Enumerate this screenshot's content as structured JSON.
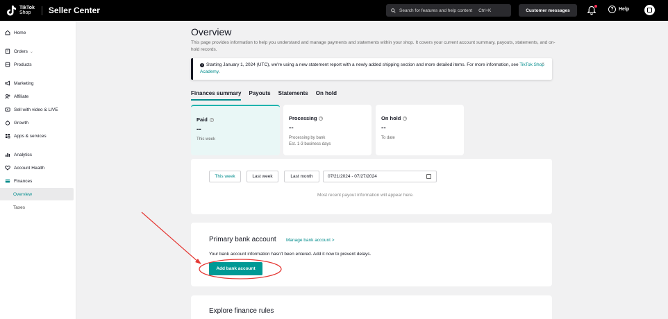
{
  "topbar": {
    "logo_text_line1": "TikTok",
    "logo_text_line2": "Shop",
    "app_name": "Seller Center",
    "search_placeholder": "Search for features and help content",
    "search_shortcut": "Ctrl+K",
    "customer_messages": "Customer messages",
    "help": "Help",
    "help_glyph": "?"
  },
  "sidebar": {
    "items": [
      {
        "label": "Home",
        "icon": "home-icon"
      },
      {
        "label": "Orders",
        "icon": "orders-icon",
        "chevron": "⌄"
      },
      {
        "label": "Products",
        "icon": "products-icon"
      },
      {
        "label": "Marketing",
        "icon": "marketing-icon"
      },
      {
        "label": "Affiliate",
        "icon": "affiliate-icon"
      },
      {
        "label": "Sell with video & LIVE",
        "icon": "video-icon"
      },
      {
        "label": "Growth",
        "icon": "growth-icon"
      },
      {
        "label": "Apps & services",
        "icon": "apps-icon"
      },
      {
        "label": "Analytics",
        "icon": "analytics-icon"
      },
      {
        "label": "Account Health",
        "icon": "account-health-icon"
      },
      {
        "label": "Finances",
        "icon": "finances-icon"
      }
    ],
    "subitems": [
      {
        "label": "Overview",
        "active": true
      },
      {
        "label": "Taxes"
      }
    ]
  },
  "page": {
    "title": "Overview",
    "description": "This page provides information to help you understand and manage payments and statements within your shop. It covers your current account summary, payouts, statements, and on-hold records."
  },
  "notice": {
    "text": "Starting January 1, 2024 (UTC), we're using a new statement report with a newly added shipping section and more detailed items. For more information, see ",
    "link": "TikTok Shop Academy",
    "period": ".",
    "info_glyph": "i",
    "close_glyph": "×"
  },
  "tabs": [
    "Finances summary",
    "Payouts",
    "Statements",
    "On hold"
  ],
  "cards": [
    {
      "title": "Paid",
      "value": "--",
      "sub1": "This week",
      "sub2": ""
    },
    {
      "title": "Processing",
      "value": "--",
      "sub1": "Processing by bank",
      "sub2": "Est. 1-3 business days"
    },
    {
      "title": "On hold",
      "value": "--",
      "sub1": "To date",
      "sub2": ""
    }
  ],
  "card_help_glyph": "?",
  "payouts": {
    "buttons": [
      "This week",
      "Last week",
      "Last month"
    ],
    "date_range": "07/21/2024 - 07/27/2024",
    "empty_text": "Most recent payout information will appear here."
  },
  "bank": {
    "title": "Primary bank account",
    "manage_link": "Manage bank account  >",
    "description": "Your bank account information hasn't been entered. Add it now to prevent delays.",
    "add_button": "Add bank account"
  },
  "explore": {
    "title": "Explore finance rules"
  },
  "colors": {
    "accent": "#008c8c",
    "button_teal": "#009995",
    "annotation_red": "#e53935"
  }
}
